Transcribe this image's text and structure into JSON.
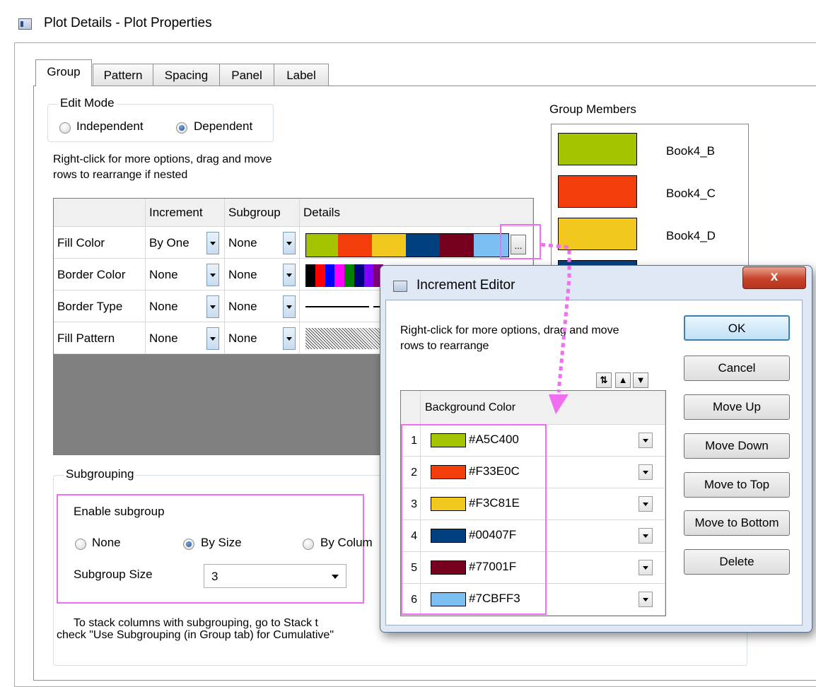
{
  "window": {
    "title": "Plot Details - Plot Properties"
  },
  "tabs": [
    {
      "label": "Group"
    },
    {
      "label": "Pattern"
    },
    {
      "label": "Spacing"
    },
    {
      "label": "Panel"
    },
    {
      "label": "Label"
    }
  ],
  "edit_mode": {
    "legend": "Edit Mode",
    "options": [
      {
        "label": "Independent",
        "selected": false
      },
      {
        "label": "Dependent",
        "selected": true
      }
    ]
  },
  "hint_text_line1": "Right-click for more options, drag and move",
  "hint_text_line2": "rows to  rearrange if nested",
  "grid": {
    "headers": [
      "",
      "Increment",
      "Subgroup",
      "Details"
    ],
    "rows": [
      {
        "name": "Fill Color",
        "increment": "By One",
        "subgroup": "None"
      },
      {
        "name": "Border Color",
        "increment": "None",
        "subgroup": "None"
      },
      {
        "name": "Border Type",
        "increment": "None",
        "subgroup": "None"
      },
      {
        "name": "Fill Pattern",
        "increment": "None",
        "subgroup": "None"
      }
    ],
    "fill_colors": [
      "#A5C400",
      "#F33E0C",
      "#F3C81E",
      "#00407F",
      "#77001F",
      "#7CBFF3"
    ],
    "border_colors": [
      "#000000",
      "#ff0000",
      "#0000ff",
      "#ff00ff",
      "#008000",
      "#000080",
      "#8000ff",
      "#800080"
    ],
    "details_button": "..."
  },
  "group_members": {
    "label": "Group Members",
    "items": [
      {
        "name": "Book4_B",
        "color": "#A5C400"
      },
      {
        "name": "Book4_C",
        "color": "#F33E0C"
      },
      {
        "name": "Book4_D",
        "color": "#F3C81E"
      }
    ]
  },
  "subgrouping": {
    "legend": "Subgrouping",
    "enable_label": "Enable subgroup",
    "options": [
      {
        "label": "None",
        "selected": false
      },
      {
        "label": "By Size",
        "selected": true
      },
      {
        "label": "By Colum",
        "selected": false
      }
    ],
    "size_label": "Subgroup Size",
    "size_value": "3",
    "note_line1": "To stack columns with subgrouping, go to Stack t",
    "note_line2": "check \"Use Subgrouping (in Group tab) for Cumulative\""
  },
  "increment_editor": {
    "title": "Increment Editor",
    "close_glyph": "x",
    "hint_line1": "Right-click for more options, drag and move",
    "hint_line2": "rows to  rearrange",
    "column_header": "Background Color",
    "rows": [
      {
        "index": "1",
        "color": "#A5C400"
      },
      {
        "index": "2",
        "color": "#F33E0C"
      },
      {
        "index": "3",
        "color": "#F3C81E"
      },
      {
        "index": "4",
        "color": "#00407F"
      },
      {
        "index": "5",
        "color": "#77001F"
      },
      {
        "index": "6",
        "color": "#7CBFF3"
      }
    ],
    "buttons": {
      "ok": "OK",
      "cancel": "Cancel",
      "move_up": "Move Up",
      "move_down": "Move Down",
      "move_to_top": "Move to Top",
      "move_to_bottom": "Move to Bottom",
      "delete": "Delete"
    }
  },
  "colors": {
    "highlight": "#f06ef0",
    "grid_bg": "#808080"
  }
}
